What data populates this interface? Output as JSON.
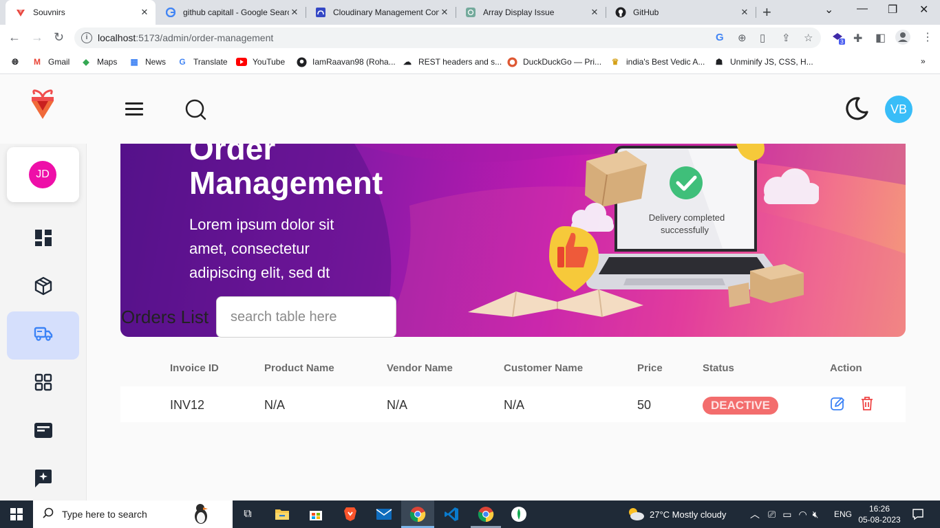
{
  "browser": {
    "tabs": [
      {
        "title": "Souvnirs",
        "active": true
      },
      {
        "title": "github capitall - Google Search"
      },
      {
        "title": "Cloudinary Management Console"
      },
      {
        "title": "Array Display Issue"
      },
      {
        "title": "GitHub"
      }
    ],
    "url_host": "localhost",
    "url_path": ":5173/admin/order-management",
    "bookmarks": [
      "Gmail",
      "Maps",
      "News",
      "Translate",
      "YouTube",
      "IamRaavan98 (Roha...",
      "REST headers and s...",
      "DuckDuckGo — Pri...",
      "india's Best Vedic A...",
      "Unminify JS, CSS, H..."
    ],
    "extension_badge": "3"
  },
  "header": {
    "user_initials": "VB"
  },
  "sidebar": {
    "profile_initials": "JD"
  },
  "banner": {
    "title_line1": "Order",
    "title_line2": "Management",
    "subtitle": "Lorem ipsum dolor sit amet, consectetur adipiscing elit, sed dt",
    "illustration_text1": "Delivery completed",
    "illustration_text2": "successfully"
  },
  "orders": {
    "title": "Orders List",
    "search_placeholder": "search table here",
    "columns": [
      "Invoice ID",
      "Product Name",
      "Vendor Name",
      "Customer Name",
      "Price",
      "Status",
      "Action"
    ],
    "rows": [
      {
        "invoice_id": "INV12",
        "product_name": "N/A",
        "vendor_name": "N/A",
        "customer_name": "N/A",
        "price": "50",
        "status": "DEACTIVE"
      }
    ]
  },
  "taskbar": {
    "search_text": "Type here to search",
    "weather": "27°C  Mostly cloudy",
    "language": "ENG",
    "time": "16:26",
    "date": "05-08-2023"
  },
  "colors": {
    "accent_active": "#d5dffc",
    "profile_avatar": "#ee0fa8",
    "user_avatar": "#38bdf8",
    "status_deactive": "#f36d6d"
  }
}
